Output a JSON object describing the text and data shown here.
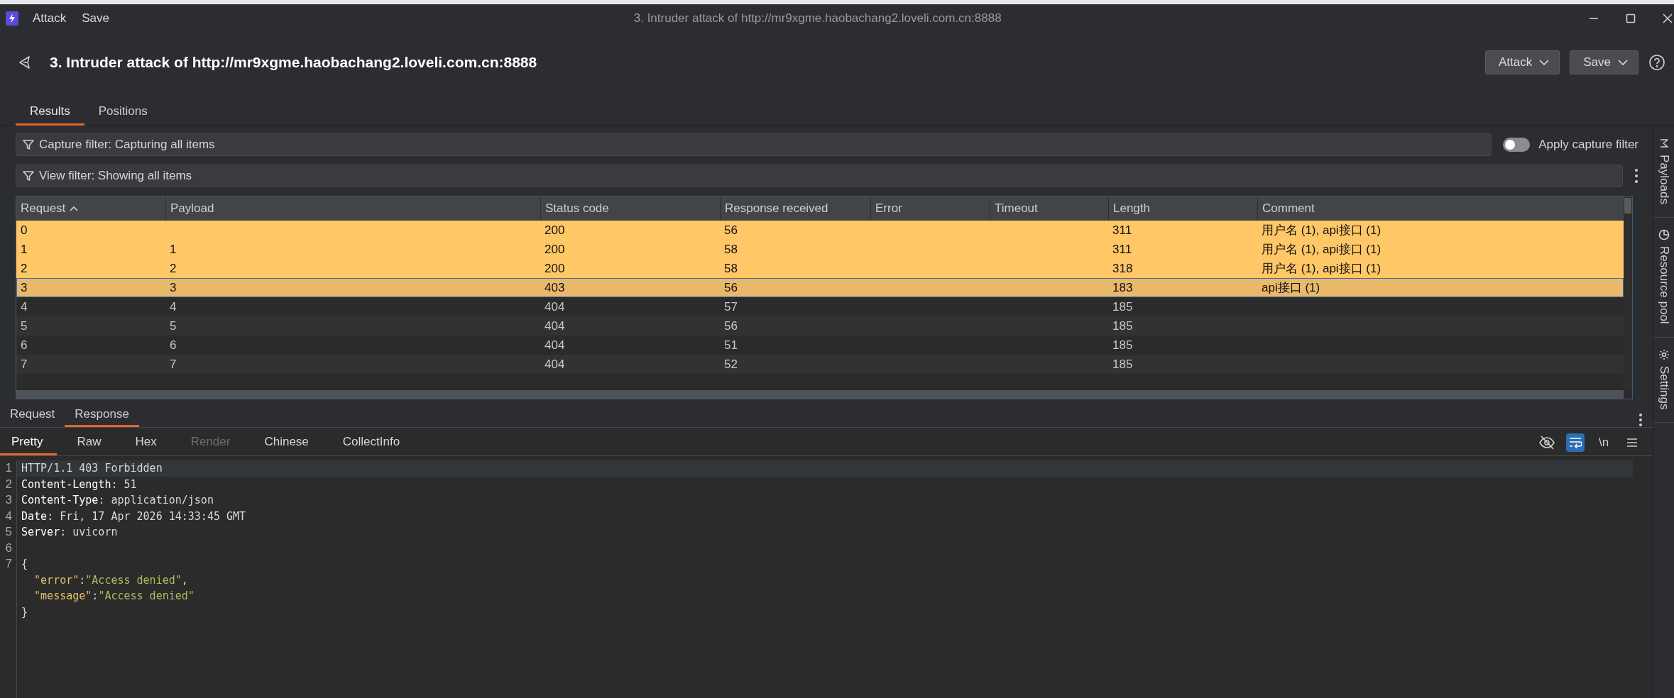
{
  "window": {
    "menu": [
      "Attack",
      "Save"
    ],
    "title": "3. Intruder attack of http://mr9xgme.haobachang2.loveli.com.cn:8888"
  },
  "header": {
    "title": "3. Intruder attack of http://mr9xgme.haobachang2.loveli.com.cn:8888",
    "buttons": [
      "Attack",
      "Save"
    ]
  },
  "tabs": [
    {
      "label": "Results",
      "selected": true
    },
    {
      "label": "Positions",
      "selected": false
    }
  ],
  "capture_filter": {
    "label": "Capture filter: Capturing all items"
  },
  "apply_capture_filter": {
    "label": "Apply capture filter",
    "on": false
  },
  "view_filter": {
    "label": "View filter: Showing all items"
  },
  "table": {
    "columns": [
      {
        "label": "Request",
        "sorted": true
      },
      {
        "label": "Payload",
        "sorted": false
      },
      {
        "label": "Status code",
        "sorted": false
      },
      {
        "label": "Response received",
        "sorted": false
      },
      {
        "label": "Error",
        "sorted": false
      },
      {
        "label": "Timeout",
        "sorted": false
      },
      {
        "label": "Length",
        "sorted": false
      },
      {
        "label": "Comment",
        "sorted": false
      }
    ],
    "rows": [
      {
        "request": "0",
        "status_code": "200",
        "response_received": "56",
        "length": "311",
        "comment": "用户名 (1), api接口 (1)",
        "color": "#ffc766",
        "selected": false
      },
      {
        "request": "1",
        "payload": "1",
        "status_code": "200",
        "response_received": "58",
        "length": "311",
        "comment": "用户名 (1), api接口 (1)",
        "color": "#ffc766",
        "selected": false
      },
      {
        "request": "2",
        "payload": "2",
        "status_code": "200",
        "response_received": "58",
        "length": "318",
        "comment": "用户名 (1), api接口 (1)",
        "color": "#ffc766",
        "selected": false
      },
      {
        "request": "3",
        "payload": "3",
        "status_code": "403",
        "response_received": "56",
        "length": "183",
        "comment": "api接口 (1)",
        "color": "#e9b86a",
        "selected": true
      },
      {
        "request": "4",
        "payload": "4",
        "status_code": "404",
        "response_received": "57",
        "length": "185",
        "selected": false
      },
      {
        "request": "5",
        "payload": "5",
        "status_code": "404",
        "response_received": "56",
        "length": "185",
        "selected": false
      },
      {
        "request": "6",
        "payload": "6",
        "status_code": "404",
        "response_received": "51",
        "length": "185",
        "selected": false
      },
      {
        "request": "7",
        "payload": "7",
        "status_code": "404",
        "response_received": "52",
        "length": "185",
        "selected": false
      }
    ]
  },
  "message_tabs": [
    {
      "label": "Request",
      "selected": false
    },
    {
      "label": "Response",
      "selected": true
    }
  ],
  "editor_tabs": [
    {
      "label": "Pretty",
      "selected": true,
      "disabled": false
    },
    {
      "label": "Raw",
      "selected": false,
      "disabled": false
    },
    {
      "label": "Hex",
      "selected": false,
      "disabled": false
    },
    {
      "label": "Render",
      "selected": false,
      "disabled": true
    },
    {
      "label": "Chinese",
      "selected": false,
      "disabled": false
    },
    {
      "label": "CollectInfo",
      "selected": false,
      "disabled": false
    }
  ],
  "editor_tools": [
    {
      "kind": "eye-off",
      "on": false
    },
    {
      "kind": "wrap",
      "on": true
    },
    {
      "kind": "text",
      "label": "\\n",
      "on": false
    },
    {
      "kind": "menu",
      "on": false
    }
  ],
  "code_lines": [
    {
      "number": "1",
      "current": true,
      "segments": [
        {
          "kind": "plain",
          "text": "HTTP/1.1 403 Forbidden"
        }
      ]
    },
    {
      "number": "2",
      "current": false,
      "segments": [
        {
          "kind": "name",
          "text": "Content-Length"
        },
        {
          "kind": "plain",
          "text": ": 51"
        }
      ]
    },
    {
      "number": "3",
      "current": false,
      "segments": [
        {
          "kind": "name",
          "text": "Content-Type"
        },
        {
          "kind": "plain",
          "text": ": application/json"
        }
      ]
    },
    {
      "number": "4",
      "current": false,
      "segments": [
        {
          "kind": "name",
          "text": "Date"
        },
        {
          "kind": "plain",
          "text": ": Fri, 17 Apr 2026 14:33:45 GMT"
        }
      ]
    },
    {
      "number": "5",
      "current": false,
      "segments": [
        {
          "kind": "name",
          "text": "Server"
        },
        {
          "kind": "plain",
          "text": ": uvicorn"
        }
      ]
    },
    {
      "number": "6",
      "current": false
    },
    {
      "number": "7",
      "current": false,
      "segments": [
        {
          "kind": "punct",
          "text": "{"
        }
      ]
    },
    {
      "current": false,
      "segments": [
        {
          "kind": "key",
          "text": "  \"error\""
        },
        {
          "kind": "punct",
          "text": ":"
        },
        {
          "kind": "string",
          "text": "\"Access denied\""
        },
        {
          "kind": "punct",
          "text": ","
        }
      ]
    },
    {
      "current": false,
      "segments": [
        {
          "kind": "key",
          "text": "  \"message\""
        },
        {
          "kind": "punct",
          "text": ":"
        },
        {
          "kind": "string",
          "text": "\"Access denied\""
        }
      ]
    },
    {
      "current": false,
      "segments": [
        {
          "kind": "punct",
          "text": "}"
        }
      ]
    }
  ],
  "sidebar": [
    {
      "kind": "payloads",
      "label": "Payloads"
    },
    {
      "kind": "resources",
      "label": "Resource pool"
    },
    {
      "kind": "settings",
      "label": "Settings"
    }
  ]
}
